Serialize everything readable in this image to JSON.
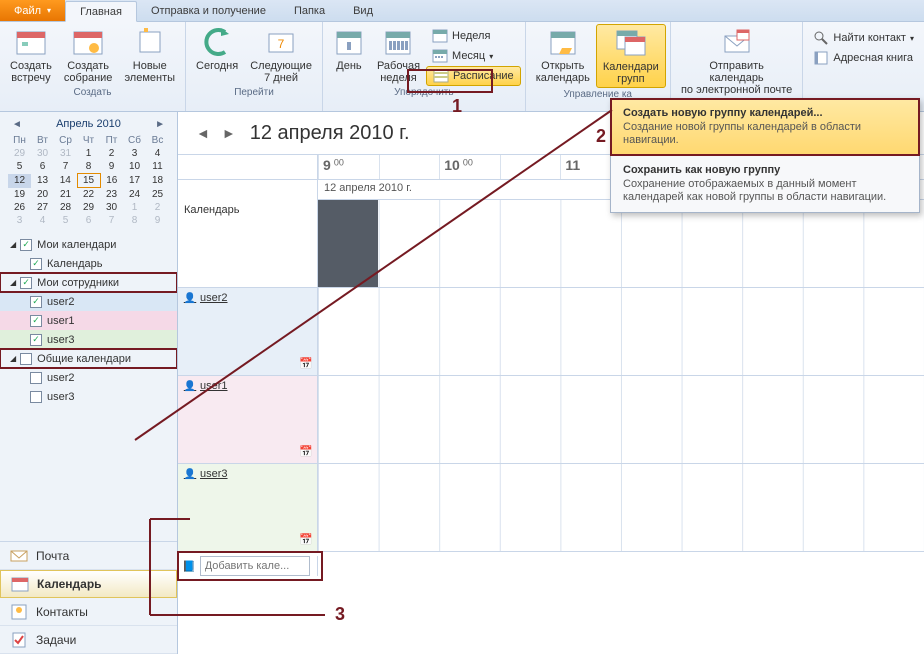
{
  "tabs": {
    "file": "Файл",
    "home": "Главная",
    "sendrecv": "Отправка и получение",
    "folder": "Папка",
    "view": "Вид"
  },
  "ribbon": {
    "create": {
      "meeting": "Создать\nвстречу",
      "gathering": "Создать\nсобрание",
      "items": "Новые\nэлементы",
      "label": "Создать"
    },
    "goto": {
      "today": "Сегодня",
      "next7": "Следующие\n7 дней",
      "label": "Перейти"
    },
    "arrange": {
      "day": "День",
      "workweek": "Рабочая\nнеделя",
      "week": "Неделя",
      "month": "Месяц",
      "schedule": "Расписание",
      "label": "Упорядочить"
    },
    "manage": {
      "open": "Открыть\nкалендарь",
      "groups": "Календари\nгрупп",
      "label": "Управление ка"
    },
    "share": {
      "send": "Отправить календарь\nпо электронной почте"
    },
    "find": {
      "find_contact": "Найти контакт",
      "addr_book": "Адресная книга"
    }
  },
  "popup": {
    "item1_title": "Создать новую группу календарей...",
    "item1_desc": "Создание новой группы календарей в области навигации.",
    "item2_title": "Сохранить как новую группу",
    "item2_desc": "Сохранение отображаемых в данный момент календарей как новой группы в области навигации."
  },
  "minical": {
    "month": "Апрель 2010",
    "dow": [
      "Пн",
      "Вт",
      "Ср",
      "Чт",
      "Пт",
      "Сб",
      "Вс"
    ],
    "weeks": [
      [
        "29",
        "30",
        "31",
        "1",
        "2",
        "3",
        "4"
      ],
      [
        "5",
        "6",
        "7",
        "8",
        "9",
        "10",
        "11"
      ],
      [
        "12",
        "13",
        "14",
        "15",
        "16",
        "17",
        "18"
      ],
      [
        "19",
        "20",
        "21",
        "22",
        "23",
        "24",
        "25"
      ],
      [
        "26",
        "27",
        "28",
        "29",
        "30",
        "1",
        "2"
      ],
      [
        "3",
        "4",
        "5",
        "6",
        "7",
        "8",
        "9"
      ]
    ],
    "today_cell": [
      2,
      3
    ],
    "sel_cell": [
      2,
      0
    ]
  },
  "tree": {
    "my_cal_hdr": "Мои календари",
    "my_cal_item": "Календарь",
    "colleagues_hdr": "Мои сотрудники",
    "u2": "user2",
    "u1": "user1",
    "u3": "user3",
    "shared_hdr": "Общие календари",
    "shared_u2": "user2",
    "shared_u3": "user3"
  },
  "navbottom": {
    "mail": "Почта",
    "calendar": "Календарь",
    "contacts": "Контакты",
    "tasks": "Задачи"
  },
  "main": {
    "date_title": "12 апреля 2010 г.",
    "hours": [
      "9 00",
      "10 00",
      "11"
    ],
    "subdate": "12 апреля 2010 г.",
    "row_calendar": "Календарь",
    "row_u2": "user2",
    "row_u1": "user1",
    "row_u3": "user3",
    "add_placeholder": "Добавить кале..."
  },
  "anno": {
    "n1": "1",
    "n2": "2",
    "n3": "3"
  }
}
